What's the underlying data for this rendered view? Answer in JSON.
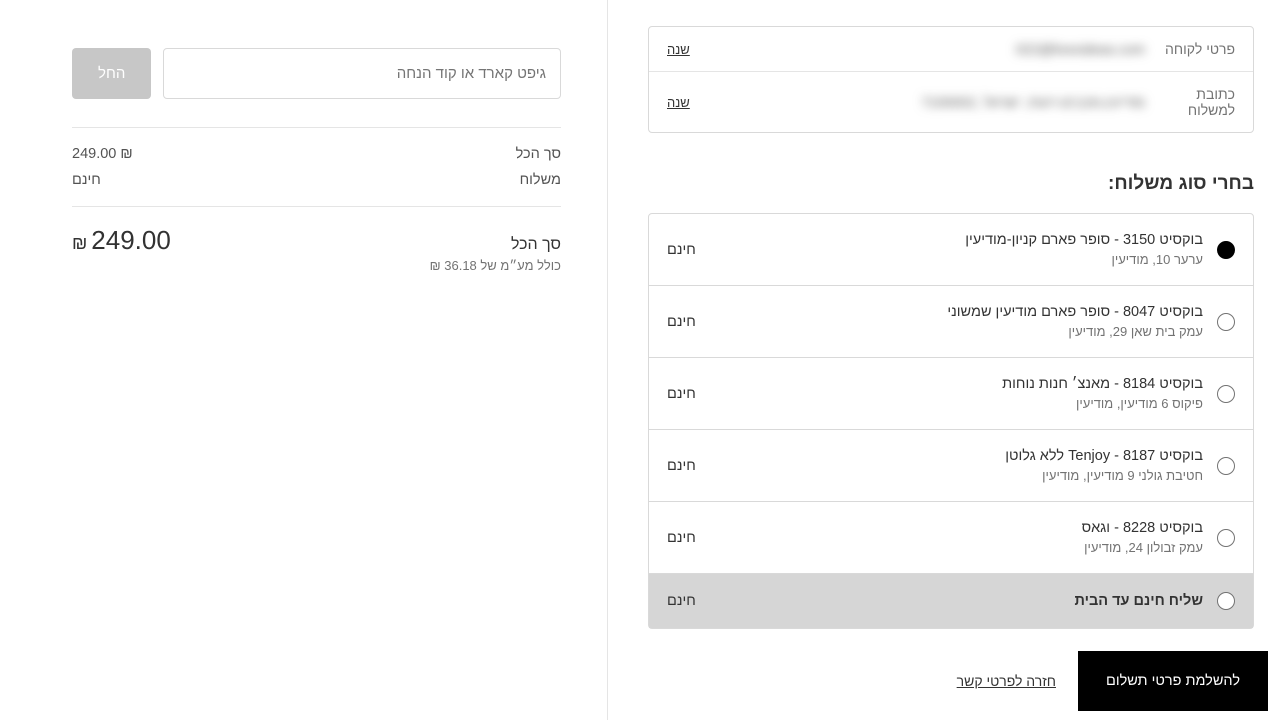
{
  "info": {
    "customer_label": "פרטי לקוחה",
    "customer_value": "022@livexideas.com",
    "customer_change": "שנה",
    "shipping_label": "כתובת למשלוח",
    "shipping_value": "7100002, מודיעין-מכבים-רעות, ישראל",
    "shipping_change": "שנה"
  },
  "shipping_section_title": "בחרי סוג משלוח:",
  "options": [
    {
      "title": "בוקסיט 3150 - סופר פארם קניון-מודיעין",
      "sub": "ערער 10, מודיעין",
      "price": "חינם",
      "selected": true,
      "highlight": false
    },
    {
      "title": "בוקסיט 8047 - סופר פארם מודיעין שמשוני",
      "sub": "עמק בית שאן 29, מודיעין",
      "price": "חינם",
      "selected": false,
      "highlight": false
    },
    {
      "title": "בוקסיט 8184 - מאנצ׳ חנות נוחות",
      "sub": "פיקוס 6 מודיעין, מודיעין",
      "price": "חינם",
      "selected": false,
      "highlight": false
    },
    {
      "title": "בוקסיט 8187 - Tenjoy ללא גלוטן",
      "sub": "חטיבת גולני 9 מודיעין, מודיעין",
      "price": "חינם",
      "selected": false,
      "highlight": false
    },
    {
      "title": "בוקסיט 8228 - וגאס",
      "sub": "עמק זבולון 24, מודיעין",
      "price": "חינם",
      "selected": false,
      "highlight": false
    },
    {
      "title": "שליח חינם עד הבית",
      "sub": "",
      "price": "חינם",
      "selected": false,
      "highlight": true
    }
  ],
  "footer": {
    "primary": "להשלמת פרטי תשלום",
    "back": "חזרה לפרטי קשר"
  },
  "promo": {
    "placeholder": "גיפט קארד או קוד הנחה",
    "apply": "החל"
  },
  "summary": {
    "subtotal_label": "סך הכל",
    "subtotal_value": "249.00 ₪",
    "shipping_label": "משלוח",
    "shipping_value": "חינם",
    "total_label": "סך הכל",
    "total_currency": "₪",
    "total_value": "249.00",
    "tax_note": "כולל מע״מ של 36.18 ₪"
  }
}
